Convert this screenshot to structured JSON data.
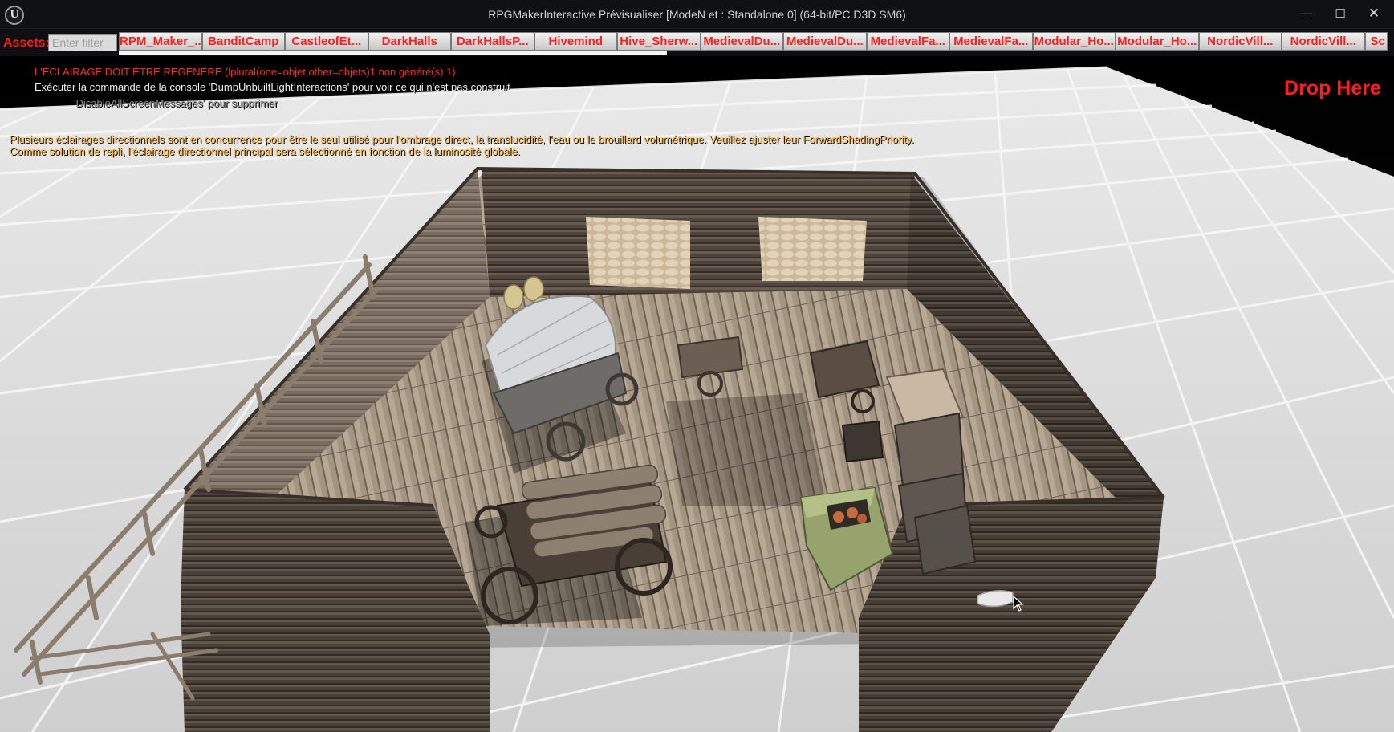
{
  "window": {
    "title": "RPGMakerInteractive Prévisualiser [ModeN et : Standalone 0]  (64-bit/PC D3D SM6)",
    "logo_text": "U",
    "controls": {
      "minimize": "—",
      "maximize": "☐",
      "close": "✕"
    }
  },
  "assets": {
    "label": "Assets:",
    "filter_placeholder": "Enter filter",
    "items": [
      "RPM_Maker_...",
      "BanditCamp",
      "CastleofEt...",
      "DarkHalls",
      "DarkHallsP...",
      "Hivemind",
      "Hive_Sherw...",
      "MedievalDu...",
      "MedievalDu...",
      "MedievalFa...",
      "MedievalFa...",
      "Modular_Ho...",
      "Modular_Ho...",
      "NordicVill...",
      "NordicVill...",
      "Sc"
    ],
    "loading_progress": 0.43
  },
  "viewport": {
    "messages": {
      "light_rebuild": "L'ÉCLAIRAGE DOIT ÊTRE REGÉNÉRÉ (lplural(one=objet,other=objets)1 non généré(s) 1)",
      "dump_command": "Exécuter la commande de la console 'DumpUnbuiltLightInteractions' pour voir ce qui n'est pas construit",
      "disable_hint": "'DisableAllScreenMessages' pour supprimer",
      "directional_1": "Plusieurs éclairages directionnels sont en concurrence pour être le seul utilisé pour l'ombrage direct, la translucidité, l'eau ou le brouillard volumétrique. Veuillez ajuster leur ForwardShadingPriority.",
      "directional_2": "Comme solution de repli, l'éclairage directionnel principal sera sélectionné en fonction de la luminosité globale."
    },
    "drop_label": "Drop Here"
  },
  "colors": {
    "accent_red": "#ff1e1e",
    "warning_orange": "#ffb43a",
    "floor_grid": "#dcdcdc"
  }
}
